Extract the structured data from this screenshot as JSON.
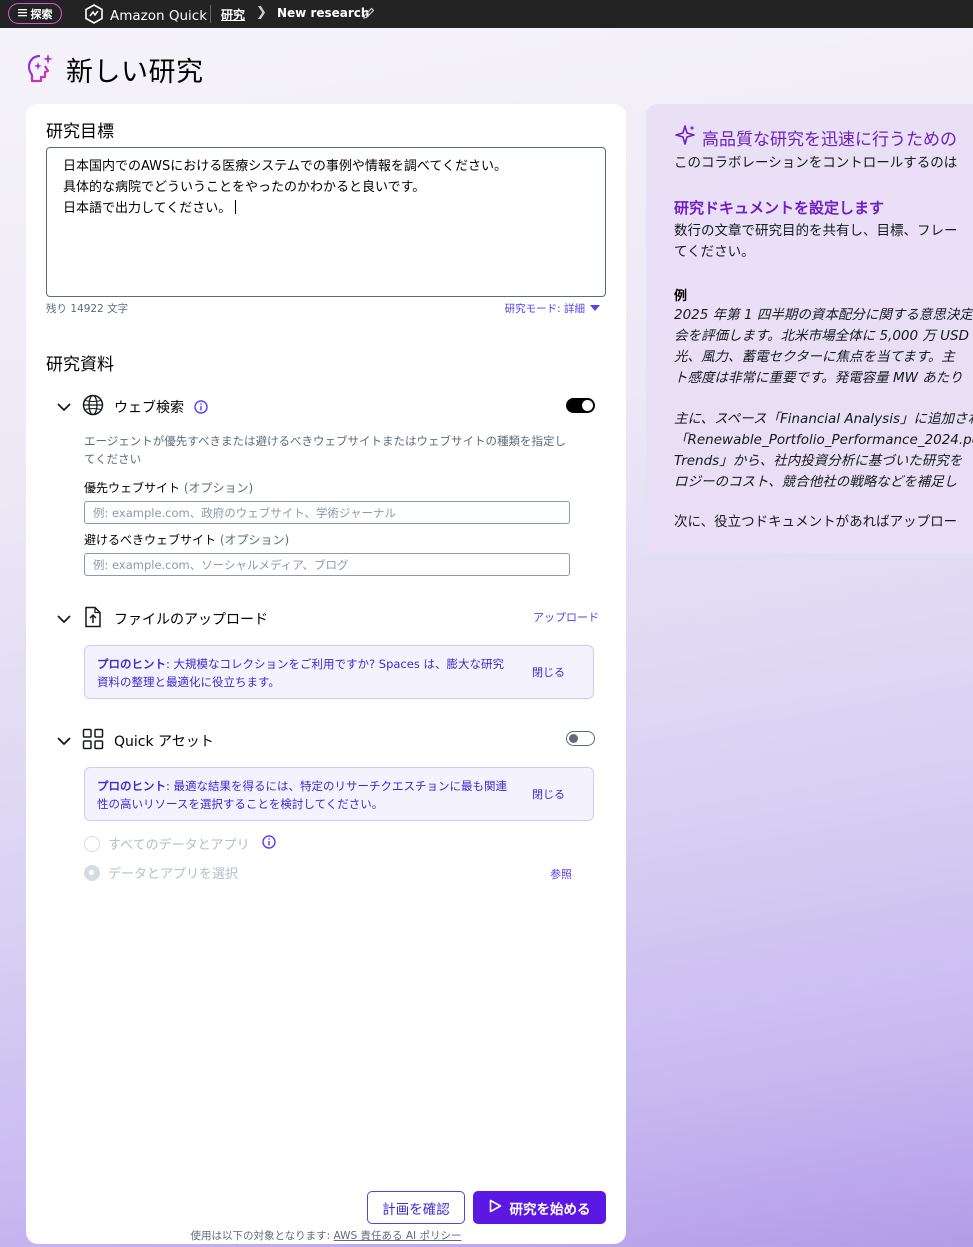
{
  "topbar": {
    "explore_label": "探索",
    "brand": "Amazon Quick",
    "breadcrumb_research": "研究",
    "breadcrumb_current": "New research"
  },
  "page": {
    "title": "新しい研究"
  },
  "goal": {
    "heading": "研究目標",
    "lines": [
      "日本国内でのAWSにおける医療システムでの事例や情報を調べてください。",
      "具体的な病院でどういうことをやったのかわかると良いです。",
      "日本語で出力してください。"
    ],
    "remaining": "残り 14922 文字",
    "mode_label": "研究モード: 詳細"
  },
  "sources": {
    "heading": "研究資料",
    "web": {
      "label": "ウェブ検索",
      "enabled": true,
      "description": "エージェントが優先すべきまたは避けるべきウェブサイトまたはウェブサイトの種類を指定してください",
      "preferred_label": "優先ウェブサイト",
      "avoid_label": "避けるべきウェブサイト",
      "optional": "(オプション)",
      "preferred_placeholder": "例: example.com、政府のウェブサイト、学術ジャーナル",
      "avoid_placeholder": "例: example.com、ソーシャルメディア、ブログ"
    },
    "upload": {
      "label": "ファイルのアップロード",
      "action": "アップロード",
      "hint_prefix": "プロのヒント",
      "hint_text": ": 大規模なコレクションをご利用ですか? Spaces は、膨大な研究資料の整理と最適化に役立ちます。",
      "close": "閉じる"
    },
    "quick_assets": {
      "label": "Quick アセット",
      "enabled": false,
      "hint_prefix": "プロのヒント",
      "hint_text": ": 最適な結果を得るには、特定のリサーチクエスチョンに最も関連性の高いリソースを選択することを検討してください。",
      "close": "閉じる",
      "option_all": "すべてのデータとアプリ",
      "option_select": "データとアプリを選択",
      "browse": "参照"
    }
  },
  "actions": {
    "review_plan": "計画を確認",
    "start_research": "研究を始める",
    "footer_prefix": "使用は以下の対象となります: ",
    "footer_link": "AWS 責任ある AI ポリシー"
  },
  "guide": {
    "title": "高品質な研究を迅速に行うための",
    "intro": "このコラボレーションをコントロールするのは",
    "sub_heading": "研究ドキュメントを設定します",
    "p1_line1": "数行の文章で研究目的を共有し、目標、フレー",
    "p1_line2": "てください。",
    "example_label": "例",
    "ex_line1": "2025 年第 1 四半期の資本配分に関する意思決定",
    "ex_line2": "会を評価します。北米市場全体に 5,000 万 USD",
    "ex_line3": "光、風力、蓄電セクターに焦点を当てます。主",
    "ex_line4": "ト感度は非常に重要です。発電容量 MW あたり",
    "ex2_line1": "主に、スペース「Financial Analysis」に追加され",
    "ex2_line2": "「Renewable_Portfolio_Performance_2024.pdf",
    "ex2_line3": "Trends」から、社内投資分析に基づいた研究を",
    "ex2_line4": "ロジーのコスト、競合他社の戦略などを補足し",
    "p3_line1": "次に、役立つドキュメントがあればアップロー"
  }
}
